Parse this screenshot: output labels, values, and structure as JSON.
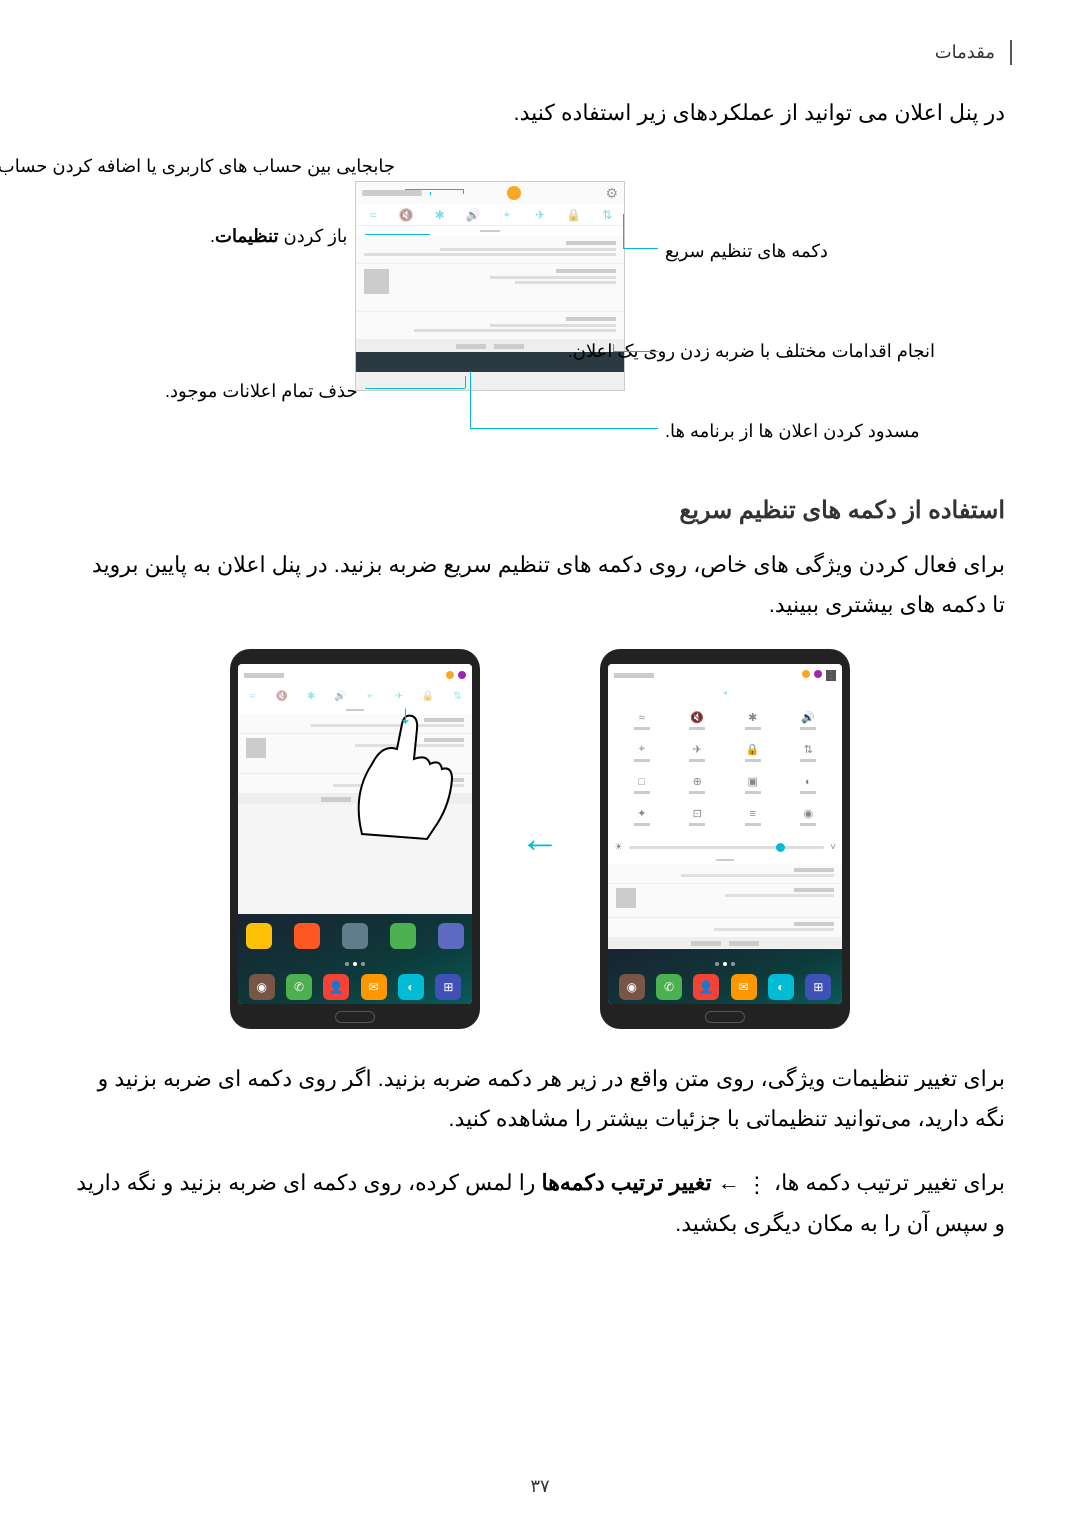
{
  "header": "مقدمات",
  "intro": "در پنل اعلان می توانید از عملکردهای زیر استفاده کنید.",
  "callouts": {
    "right_top": "جابجایی بین حساب های کاربری یا اضافه کردن حساب های جدید.",
    "right_settings_pre": "باز کردن ",
    "right_settings_bold": "تنظیمات",
    "right_settings_post": ".",
    "right_clear": "حذف تمام اعلانات موجود.",
    "left_quick": "دکمه های تنظیم سریع",
    "left_notif": "انجام اقدامات مختلف با ضربه زدن روی یک اعلان.",
    "left_block": "مسدود کردن اعلان ها از برنامه ها."
  },
  "section_heading": "استفاده از دکمه های تنظیم سریع",
  "para1": "برای فعال کردن ویژگی های خاص، روی دکمه های تنظیم سریع ضربه بزنید. در پنل اعلان به پایین بروید تا دکمه های بیشتری ببینید.",
  "para2_pre": "برای تغییر تنظیمات ویژگی، روی متن واقع در زیر هر دکمه ضربه بزنید. اگر روی دکمه ای ضربه بزنید و نگه دارید، می‌توانید تنظیماتی با جزئیات بیشتر را مشاهده کنید.",
  "para3_pre": "برای تغییر ترتیب دکمه ها، ",
  "para3_arrow": " ← ",
  "para3_bold": "تغییر ترتیب دکمه‌ها",
  "para3_post": " را لمس کرده، روی دکمه ای ضربه بزنید و نگه دارید و سپس آن را به مکان دیگری بکشید.",
  "page_number": "۳۷"
}
